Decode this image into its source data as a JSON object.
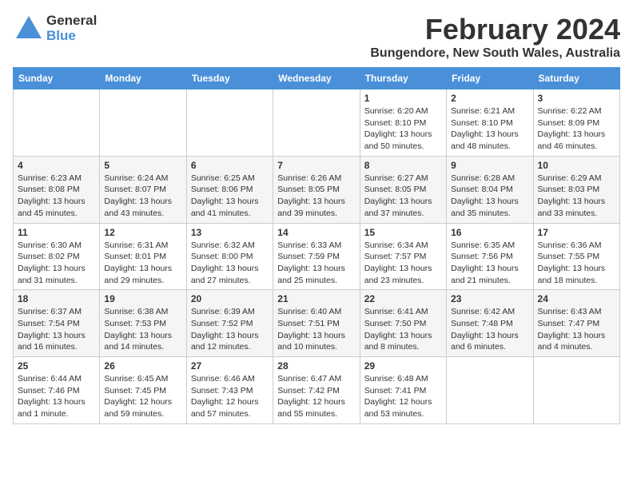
{
  "header": {
    "logo_general": "General",
    "logo_blue": "Blue",
    "title": "February 2024",
    "subtitle": "Bungendore, New South Wales, Australia"
  },
  "days_of_week": [
    "Sunday",
    "Monday",
    "Tuesday",
    "Wednesday",
    "Thursday",
    "Friday",
    "Saturday"
  ],
  "weeks": [
    {
      "days": [
        {
          "number": "",
          "info": ""
        },
        {
          "number": "",
          "info": ""
        },
        {
          "number": "",
          "info": ""
        },
        {
          "number": "",
          "info": ""
        },
        {
          "number": "1",
          "info": "Sunrise: 6:20 AM\nSunset: 8:10 PM\nDaylight: 13 hours\nand 50 minutes."
        },
        {
          "number": "2",
          "info": "Sunrise: 6:21 AM\nSunset: 8:10 PM\nDaylight: 13 hours\nand 48 minutes."
        },
        {
          "number": "3",
          "info": "Sunrise: 6:22 AM\nSunset: 8:09 PM\nDaylight: 13 hours\nand 46 minutes."
        }
      ]
    },
    {
      "days": [
        {
          "number": "4",
          "info": "Sunrise: 6:23 AM\nSunset: 8:08 PM\nDaylight: 13 hours\nand 45 minutes."
        },
        {
          "number": "5",
          "info": "Sunrise: 6:24 AM\nSunset: 8:07 PM\nDaylight: 13 hours\nand 43 minutes."
        },
        {
          "number": "6",
          "info": "Sunrise: 6:25 AM\nSunset: 8:06 PM\nDaylight: 13 hours\nand 41 minutes."
        },
        {
          "number": "7",
          "info": "Sunrise: 6:26 AM\nSunset: 8:05 PM\nDaylight: 13 hours\nand 39 minutes."
        },
        {
          "number": "8",
          "info": "Sunrise: 6:27 AM\nSunset: 8:05 PM\nDaylight: 13 hours\nand 37 minutes."
        },
        {
          "number": "9",
          "info": "Sunrise: 6:28 AM\nSunset: 8:04 PM\nDaylight: 13 hours\nand 35 minutes."
        },
        {
          "number": "10",
          "info": "Sunrise: 6:29 AM\nSunset: 8:03 PM\nDaylight: 13 hours\nand 33 minutes."
        }
      ]
    },
    {
      "days": [
        {
          "number": "11",
          "info": "Sunrise: 6:30 AM\nSunset: 8:02 PM\nDaylight: 13 hours\nand 31 minutes."
        },
        {
          "number": "12",
          "info": "Sunrise: 6:31 AM\nSunset: 8:01 PM\nDaylight: 13 hours\nand 29 minutes."
        },
        {
          "number": "13",
          "info": "Sunrise: 6:32 AM\nSunset: 8:00 PM\nDaylight: 13 hours\nand 27 minutes."
        },
        {
          "number": "14",
          "info": "Sunrise: 6:33 AM\nSunset: 7:59 PM\nDaylight: 13 hours\nand 25 minutes."
        },
        {
          "number": "15",
          "info": "Sunrise: 6:34 AM\nSunset: 7:57 PM\nDaylight: 13 hours\nand 23 minutes."
        },
        {
          "number": "16",
          "info": "Sunrise: 6:35 AM\nSunset: 7:56 PM\nDaylight: 13 hours\nand 21 minutes."
        },
        {
          "number": "17",
          "info": "Sunrise: 6:36 AM\nSunset: 7:55 PM\nDaylight: 13 hours\nand 18 minutes."
        }
      ]
    },
    {
      "days": [
        {
          "number": "18",
          "info": "Sunrise: 6:37 AM\nSunset: 7:54 PM\nDaylight: 13 hours\nand 16 minutes."
        },
        {
          "number": "19",
          "info": "Sunrise: 6:38 AM\nSunset: 7:53 PM\nDaylight: 13 hours\nand 14 minutes."
        },
        {
          "number": "20",
          "info": "Sunrise: 6:39 AM\nSunset: 7:52 PM\nDaylight: 13 hours\nand 12 minutes."
        },
        {
          "number": "21",
          "info": "Sunrise: 6:40 AM\nSunset: 7:51 PM\nDaylight: 13 hours\nand 10 minutes."
        },
        {
          "number": "22",
          "info": "Sunrise: 6:41 AM\nSunset: 7:50 PM\nDaylight: 13 hours\nand 8 minutes."
        },
        {
          "number": "23",
          "info": "Sunrise: 6:42 AM\nSunset: 7:48 PM\nDaylight: 13 hours\nand 6 minutes."
        },
        {
          "number": "24",
          "info": "Sunrise: 6:43 AM\nSunset: 7:47 PM\nDaylight: 13 hours\nand 4 minutes."
        }
      ]
    },
    {
      "days": [
        {
          "number": "25",
          "info": "Sunrise: 6:44 AM\nSunset: 7:46 PM\nDaylight: 13 hours\nand 1 minute."
        },
        {
          "number": "26",
          "info": "Sunrise: 6:45 AM\nSunset: 7:45 PM\nDaylight: 12 hours\nand 59 minutes."
        },
        {
          "number": "27",
          "info": "Sunrise: 6:46 AM\nSunset: 7:43 PM\nDaylight: 12 hours\nand 57 minutes."
        },
        {
          "number": "28",
          "info": "Sunrise: 6:47 AM\nSunset: 7:42 PM\nDaylight: 12 hours\nand 55 minutes."
        },
        {
          "number": "29",
          "info": "Sunrise: 6:48 AM\nSunset: 7:41 PM\nDaylight: 12 hours\nand 53 minutes."
        },
        {
          "number": "",
          "info": ""
        },
        {
          "number": "",
          "info": ""
        }
      ]
    }
  ]
}
